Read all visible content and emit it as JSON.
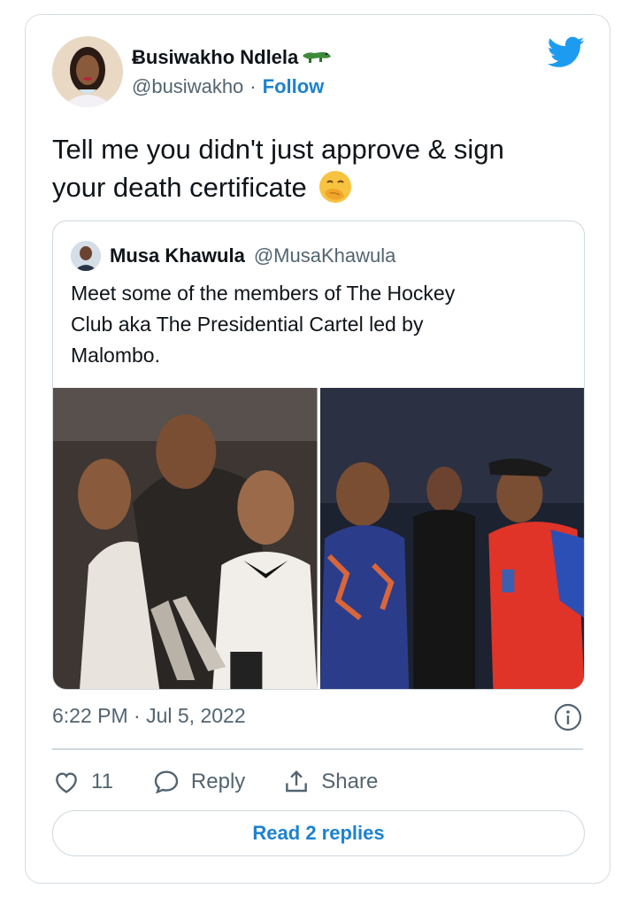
{
  "author": {
    "display_name": "Ƀusiwakho Ndlela",
    "handle": "@busiwakho",
    "separator": "·",
    "follow_label": "Follow"
  },
  "tweet": {
    "text_line1": "Tell me you didn't just approve & sign",
    "text_line2": "your death certificate"
  },
  "quoted_tweet": {
    "display_name": "Musa Khawula",
    "handle": "@MusaKhawula",
    "text_line1": "Meet some of the members of The Hockey",
    "text_line2": "Club aka The Presidential Cartel led by",
    "text_line3": "Malombo."
  },
  "meta": {
    "timestamp": "6:22 PM · Jul 5, 2022"
  },
  "actions": {
    "like_count": "11",
    "reply_label": "Reply",
    "share_label": "Share"
  },
  "footer": {
    "read_replies_label": "Read 2 replies"
  },
  "colors": {
    "accent": "#1d9bf0",
    "link": "#1d82cf",
    "muted": "#536471",
    "border": "#cfd9de"
  },
  "icons": [
    "twitter-bird-icon",
    "crocodile-emoji-icon",
    "face-with-hand-over-mouth-emoji-icon",
    "info-icon",
    "heart-icon",
    "reply-bubble-icon",
    "share-icon"
  ]
}
